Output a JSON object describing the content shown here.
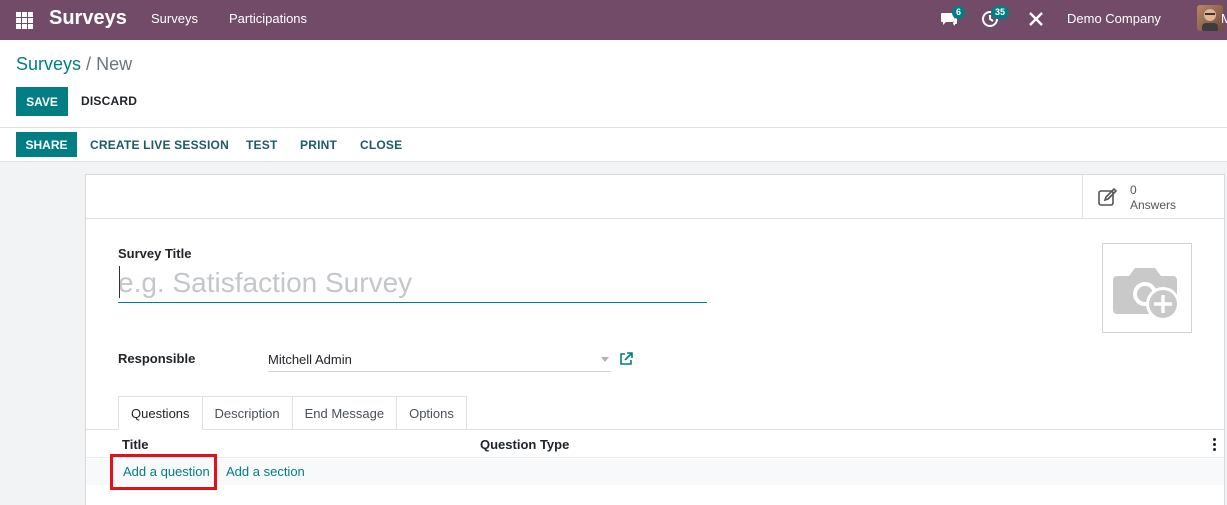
{
  "navbar": {
    "brand": "Surveys",
    "menu": [
      "Surveys",
      "Participations"
    ],
    "messages_badge": "6",
    "activities_badge": "35",
    "company": "Demo Company",
    "user_initial_edge": "M"
  },
  "breadcrumb": {
    "parent": "Surveys",
    "separator": "/",
    "current": "New"
  },
  "actions": {
    "save": "SAVE",
    "discard": "DISCARD"
  },
  "statusbar": {
    "share": "SHARE",
    "create_live_session": "CREATE LIVE SESSION",
    "test": "TEST",
    "print": "PRINT",
    "close": "CLOSE"
  },
  "stat_button": {
    "value": "0",
    "label": "Answers"
  },
  "form": {
    "title_label": "Survey Title",
    "title_placeholder": "e.g. Satisfaction Survey",
    "responsible_label": "Responsible",
    "responsible_value": "Mitchell Admin"
  },
  "tabs": [
    "Questions",
    "Description",
    "End Message",
    "Options"
  ],
  "questions_list": {
    "columns": [
      "Title",
      "Question Type"
    ],
    "add_question": "Add a question",
    "add_section": "Add a section"
  },
  "colors": {
    "navbar": "#714b67",
    "primary": "#017e84",
    "highlight": "#e3101a"
  }
}
